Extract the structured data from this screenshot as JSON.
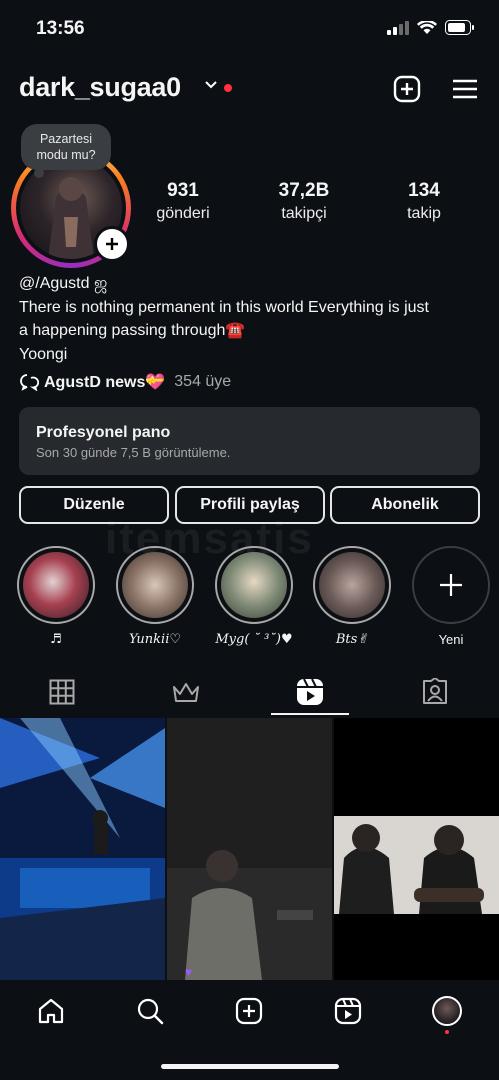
{
  "status_bar": {
    "time": "13:56"
  },
  "header": {
    "username": "dark_sugaa0"
  },
  "profile": {
    "note": [
      "Pazartesi",
      "modu mu?"
    ],
    "stats": [
      {
        "value": "931",
        "label": "gönderi"
      },
      {
        "value": "37,2B",
        "label": "takipçi"
      },
      {
        "value": "134",
        "label": "takip"
      }
    ],
    "bio_lines": [
      "@/Agustd ஜ",
      "There is nothing permanent in this world Everything is just",
      "a happening passing through☎️",
      "Yoongi"
    ],
    "channel": {
      "name": "AgustD news💝",
      "members": "354 üye"
    }
  },
  "pro_dashboard": {
    "title": "Profesyonel pano",
    "subtitle": "Son 30 günde 7,5 B görüntüleme."
  },
  "buttons": {
    "edit": "Düzenle",
    "share": "Profili paylaş",
    "subscribe": "Abonelik"
  },
  "highlights": [
    {
      "label": "♬"
    },
    {
      "label": "Yunkii♡"
    },
    {
      "label": "Myg( ˘ ³˘)♥"
    },
    {
      "label": "Bts✌︎"
    },
    {
      "label": "Yeni"
    }
  ],
  "tabs": [
    "grid-icon",
    "crown-icon",
    "reels-icon",
    "tagged-icon"
  ],
  "watermark": "itemsatis",
  "colors": {
    "background": "#0c1014",
    "card": "#262a2f",
    "notification": "#ff3040"
  }
}
